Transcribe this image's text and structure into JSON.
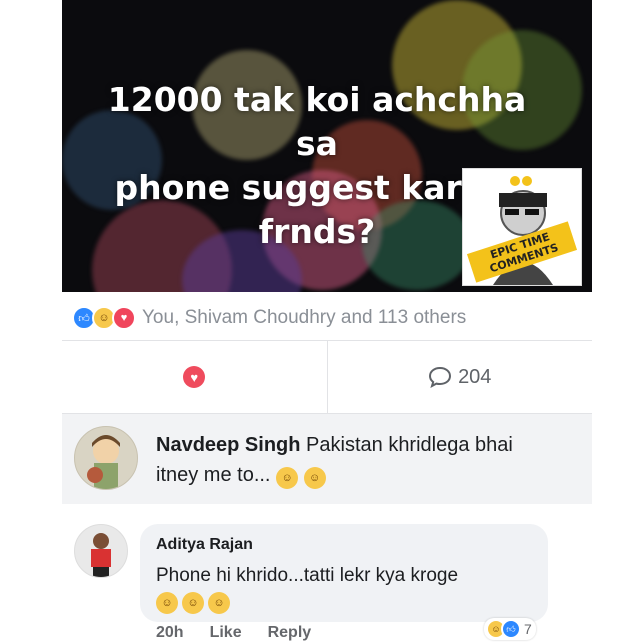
{
  "post": {
    "text_line1": "12000 tak koi achchha sa",
    "text_line2": "phone suggest kar do frnds?",
    "watermark_text": "EPIC TIME COMMENTS"
  },
  "reactions": {
    "icons": [
      "like-icon",
      "haha-icon",
      "love-icon"
    ],
    "summary": "You, Shivam Choudhry and 113 others"
  },
  "actions": {
    "love_icon": "love-icon",
    "comments_icon": "comment-bubble-icon",
    "comments_count": "204"
  },
  "comments": [
    {
      "name": "Navdeep Singh",
      "text_part1": "Pakistan khridlega bhai",
      "text_part2": "itney me to..."
    },
    {
      "name": "Aditya Rajan",
      "text": "Phone hi khrido...tatti lekr kya kroge",
      "time": "20h",
      "like_label": "Like",
      "reply_label": "Reply",
      "reaction_count": "7"
    }
  ],
  "colors": {
    "accent_blue": "#2d88ff",
    "love_red": "#ef4b5d",
    "haha_yellow": "#f7c84b",
    "comment_bg": "#f2f3f5"
  }
}
